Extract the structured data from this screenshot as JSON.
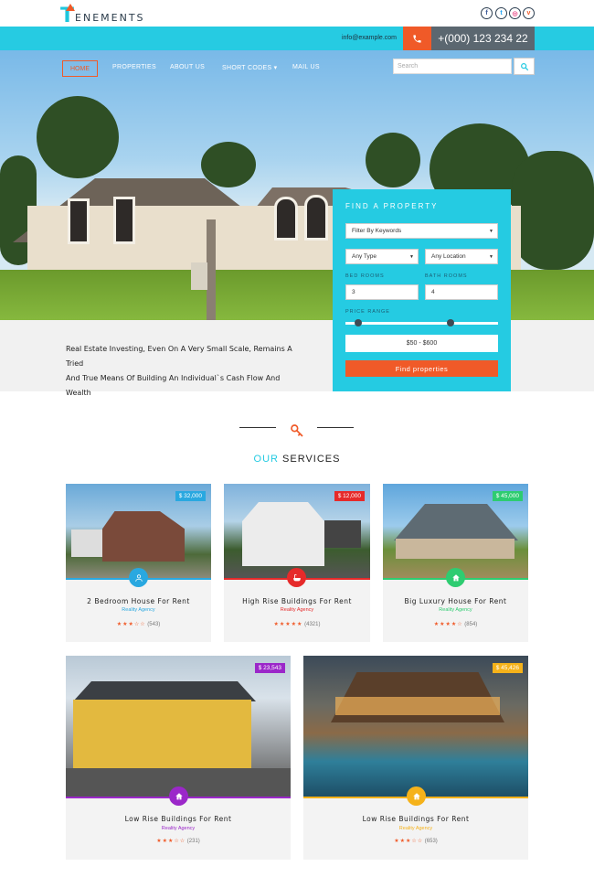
{
  "brand": {
    "logo_letter": "T",
    "logo_rest": "ENEMENTS",
    "accent": "#26cbe2",
    "orange": "#f05a28"
  },
  "social": [
    {
      "icon": "facebook-icon",
      "glyph": "f"
    },
    {
      "icon": "twitter-icon",
      "glyph": "t"
    },
    {
      "icon": "dribbble-icon",
      "glyph": "◎"
    },
    {
      "icon": "vimeo-icon",
      "glyph": "v"
    }
  ],
  "topbar": {
    "email": "info@example.com",
    "phone": "+(000) 123 234 22",
    "phone_icon": "phone-icon"
  },
  "nav": {
    "items": [
      "HOME",
      "PROPERTIES",
      "ABOUT US",
      "SHORT CODES ▾",
      "MAIL US"
    ],
    "search_placeholder": "Search"
  },
  "hero": {
    "caption_line1": "Real Estate Investing, Even On A Very Small Scale, Remains A Tried",
    "caption_line2": "And True Means Of Building An Individual`s Cash Flow And Wealth"
  },
  "finder": {
    "title": "FIND A PROPERTY",
    "keywords": "Filter By Keywords",
    "type": "Any Type",
    "location": "Any Location",
    "bed_label": "BED ROOMS",
    "bath_label": "BATH ROOMS",
    "bed_value": "3",
    "bath_value": "4",
    "price_label": "PRICE RANGE",
    "range": "$50 - $600",
    "button": "Find properties"
  },
  "services": {
    "title_accent": "OUR",
    "title_rest": "SERVICES"
  },
  "cards": [
    {
      "price": "$ 32,000",
      "title": "2 Bedroom House For Rent",
      "agency": "Reality Agency",
      "stars": "★★★☆☆",
      "count": "(543)",
      "color": "#29a8e0",
      "icon": "user-icon"
    },
    {
      "price": "$ 12,000",
      "title": "High Rise Buildings For Rent",
      "agency": "Reality Agency",
      "stars": "★★★★★",
      "count": "(4321)",
      "color": "#e62a2a",
      "icon": "bath-icon"
    },
    {
      "price": "$ 45,000",
      "title": "Big Luxury House For Rent",
      "agency": "Reality Agency",
      "stars": "★★★★☆",
      "count": "(854)",
      "color": "#2ecc71",
      "icon": "home-icon"
    },
    {
      "price": "$ 23,543",
      "title": "Low Rise Buildings For Rent",
      "agency": "Reality Agency",
      "stars": "★★★☆☆",
      "count": "(231)",
      "color": "#9b27c9",
      "icon": "home-icon"
    },
    {
      "price": "$ 45,426",
      "title": "Low Rise Buildings For Rent",
      "agency": "Reality Agency",
      "stars": "★★★☆☆",
      "count": "(653)",
      "color": "#f5b21a",
      "icon": "home-icon"
    }
  ]
}
